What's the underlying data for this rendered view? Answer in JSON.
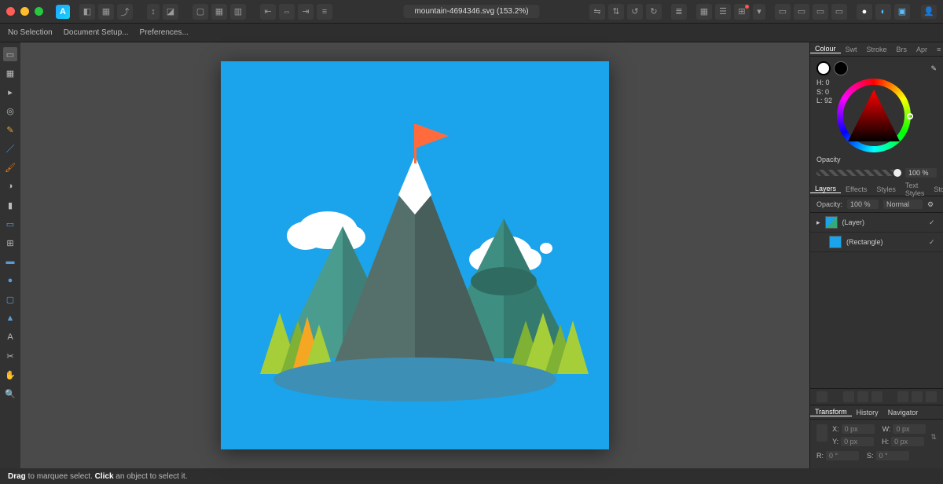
{
  "titlebar": {
    "filename": "mountain-4694346.svg (153.2%)"
  },
  "contextbar": {
    "selection": "No Selection",
    "doc_setup": "Document Setup...",
    "preferences": "Preferences..."
  },
  "colour_panel": {
    "tabs": [
      "Colour",
      "Swt",
      "Stroke",
      "Brs",
      "Apr"
    ],
    "h_label": "H: 0",
    "s_label": "S: 0",
    "l_label": "L: 92",
    "opacity_label": "Opacity",
    "opacity_value": "100 %"
  },
  "layers_panel": {
    "tabs": [
      "Layers",
      "Effects",
      "Styles",
      "Text Styles",
      "Stock"
    ],
    "opacity_label": "Opacity:",
    "opacity_value": "100 %",
    "blend_mode": "Normal",
    "items": [
      {
        "name": "(Layer)"
      },
      {
        "name": "(Rectangle)"
      }
    ]
  },
  "transform_panel": {
    "tabs": [
      "Transform",
      "History",
      "Navigator"
    ],
    "x_label": "X:",
    "x_value": "0 px",
    "w_label": "W:",
    "w_value": "0 px",
    "y_label": "Y:",
    "y_value": "0 px",
    "h_label": "H:",
    "h_value": "0 px",
    "r_label": "R:",
    "r_value": "0 °",
    "s_label": "S:",
    "s_value": "0 °"
  },
  "statusbar": {
    "drag_bold": "Drag",
    "drag_text": " to marquee select. ",
    "click_bold": "Click",
    "click_text": " an object to select it."
  }
}
